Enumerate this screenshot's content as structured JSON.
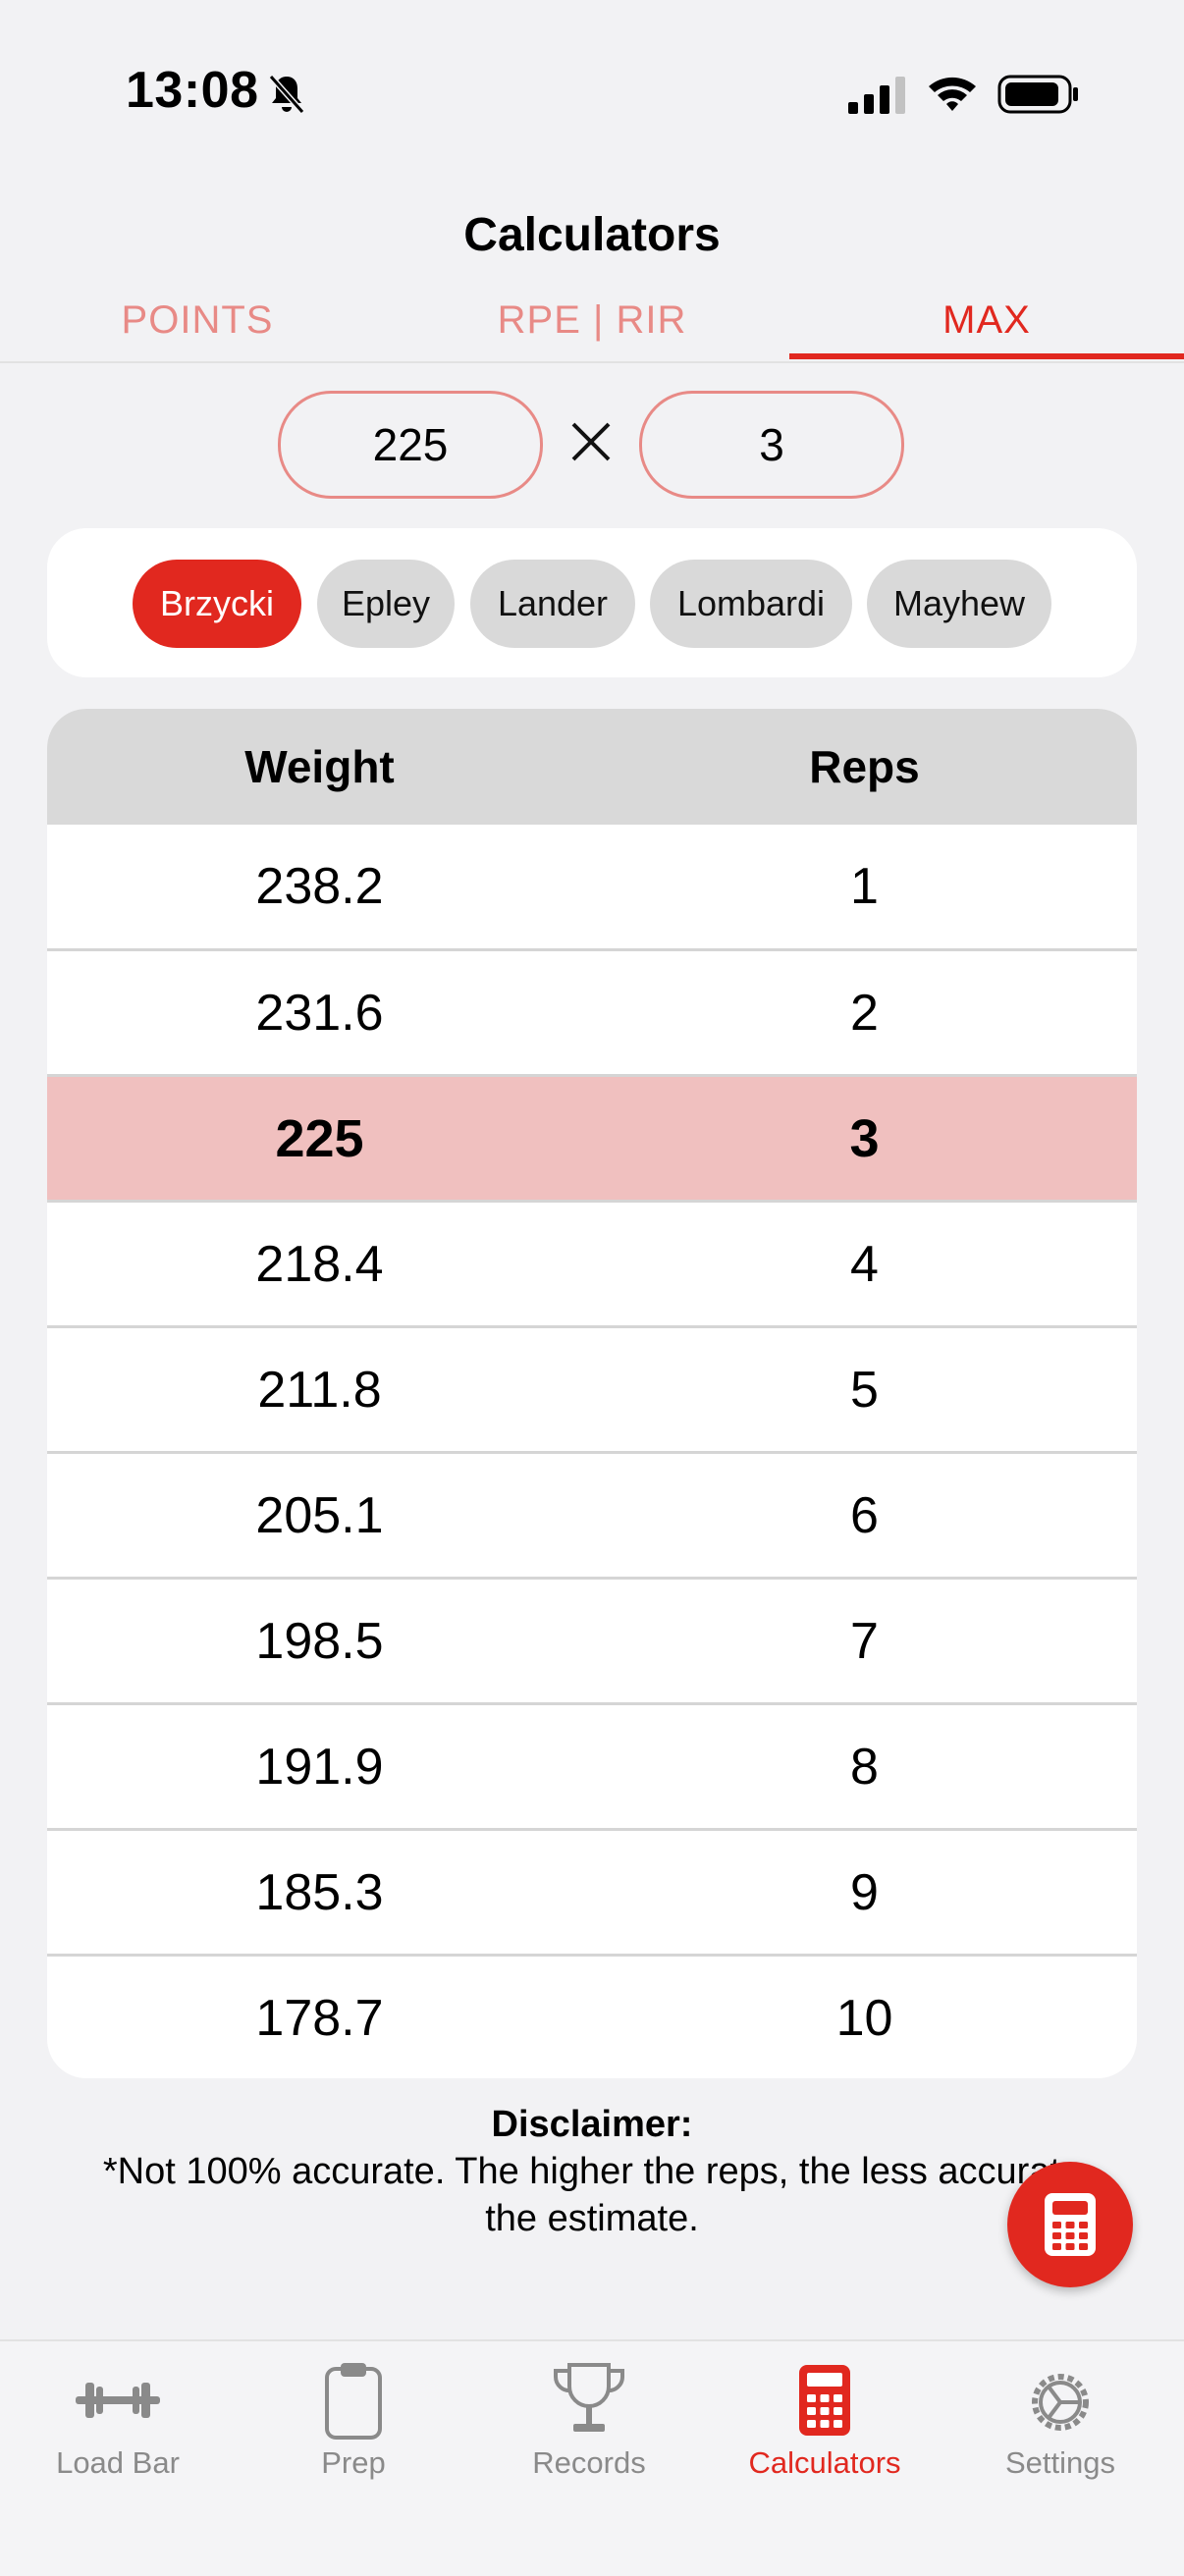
{
  "status_bar": {
    "time": "13:08"
  },
  "header": {
    "title": "Calculators"
  },
  "tabs": [
    {
      "label": "POINTS",
      "active": false
    },
    {
      "label": "RPE | RIR",
      "active": false
    },
    {
      "label": "MAX",
      "active": true
    }
  ],
  "inputs": {
    "weight": "225",
    "reps": "3"
  },
  "formulas": [
    {
      "label": "Brzycki",
      "active": true
    },
    {
      "label": "Epley",
      "active": false
    },
    {
      "label": "Lander",
      "active": false
    },
    {
      "label": "Lombardi",
      "active": false
    },
    {
      "label": "Mayhew",
      "active": false
    }
  ],
  "table": {
    "headers": {
      "weight": "Weight",
      "reps": "Reps"
    },
    "rows": [
      {
        "weight": "238.2",
        "reps": "1"
      },
      {
        "weight": "231.6",
        "reps": "2"
      },
      {
        "weight": "225",
        "reps": "3",
        "highlighted": true
      },
      {
        "weight": "218.4",
        "reps": "4"
      },
      {
        "weight": "211.8",
        "reps": "5"
      },
      {
        "weight": "205.1",
        "reps": "6"
      },
      {
        "weight": "198.5",
        "reps": "7"
      },
      {
        "weight": "191.9",
        "reps": "8"
      },
      {
        "weight": "185.3",
        "reps": "9"
      },
      {
        "weight": "178.7",
        "reps": "10"
      }
    ]
  },
  "disclaimer": {
    "title": "Disclaimer:",
    "line1": "*Not 100% accurate. The higher the reps, the less accurate",
    "line2": "the estimate."
  },
  "tab_bar": [
    {
      "label": "Load Bar",
      "icon": "barbell-icon",
      "active": false
    },
    {
      "label": "Prep",
      "icon": "clipboard-icon",
      "active": false
    },
    {
      "label": "Records",
      "icon": "trophy-icon",
      "active": false
    },
    {
      "label": "Calculators",
      "icon": "calculator-icon",
      "active": true
    },
    {
      "label": "Settings",
      "icon": "gear-icon",
      "active": false
    }
  ],
  "colors": {
    "accent": "#e1281f",
    "accent_light": "#e88a86",
    "highlight_row": "#f0c0bf"
  }
}
